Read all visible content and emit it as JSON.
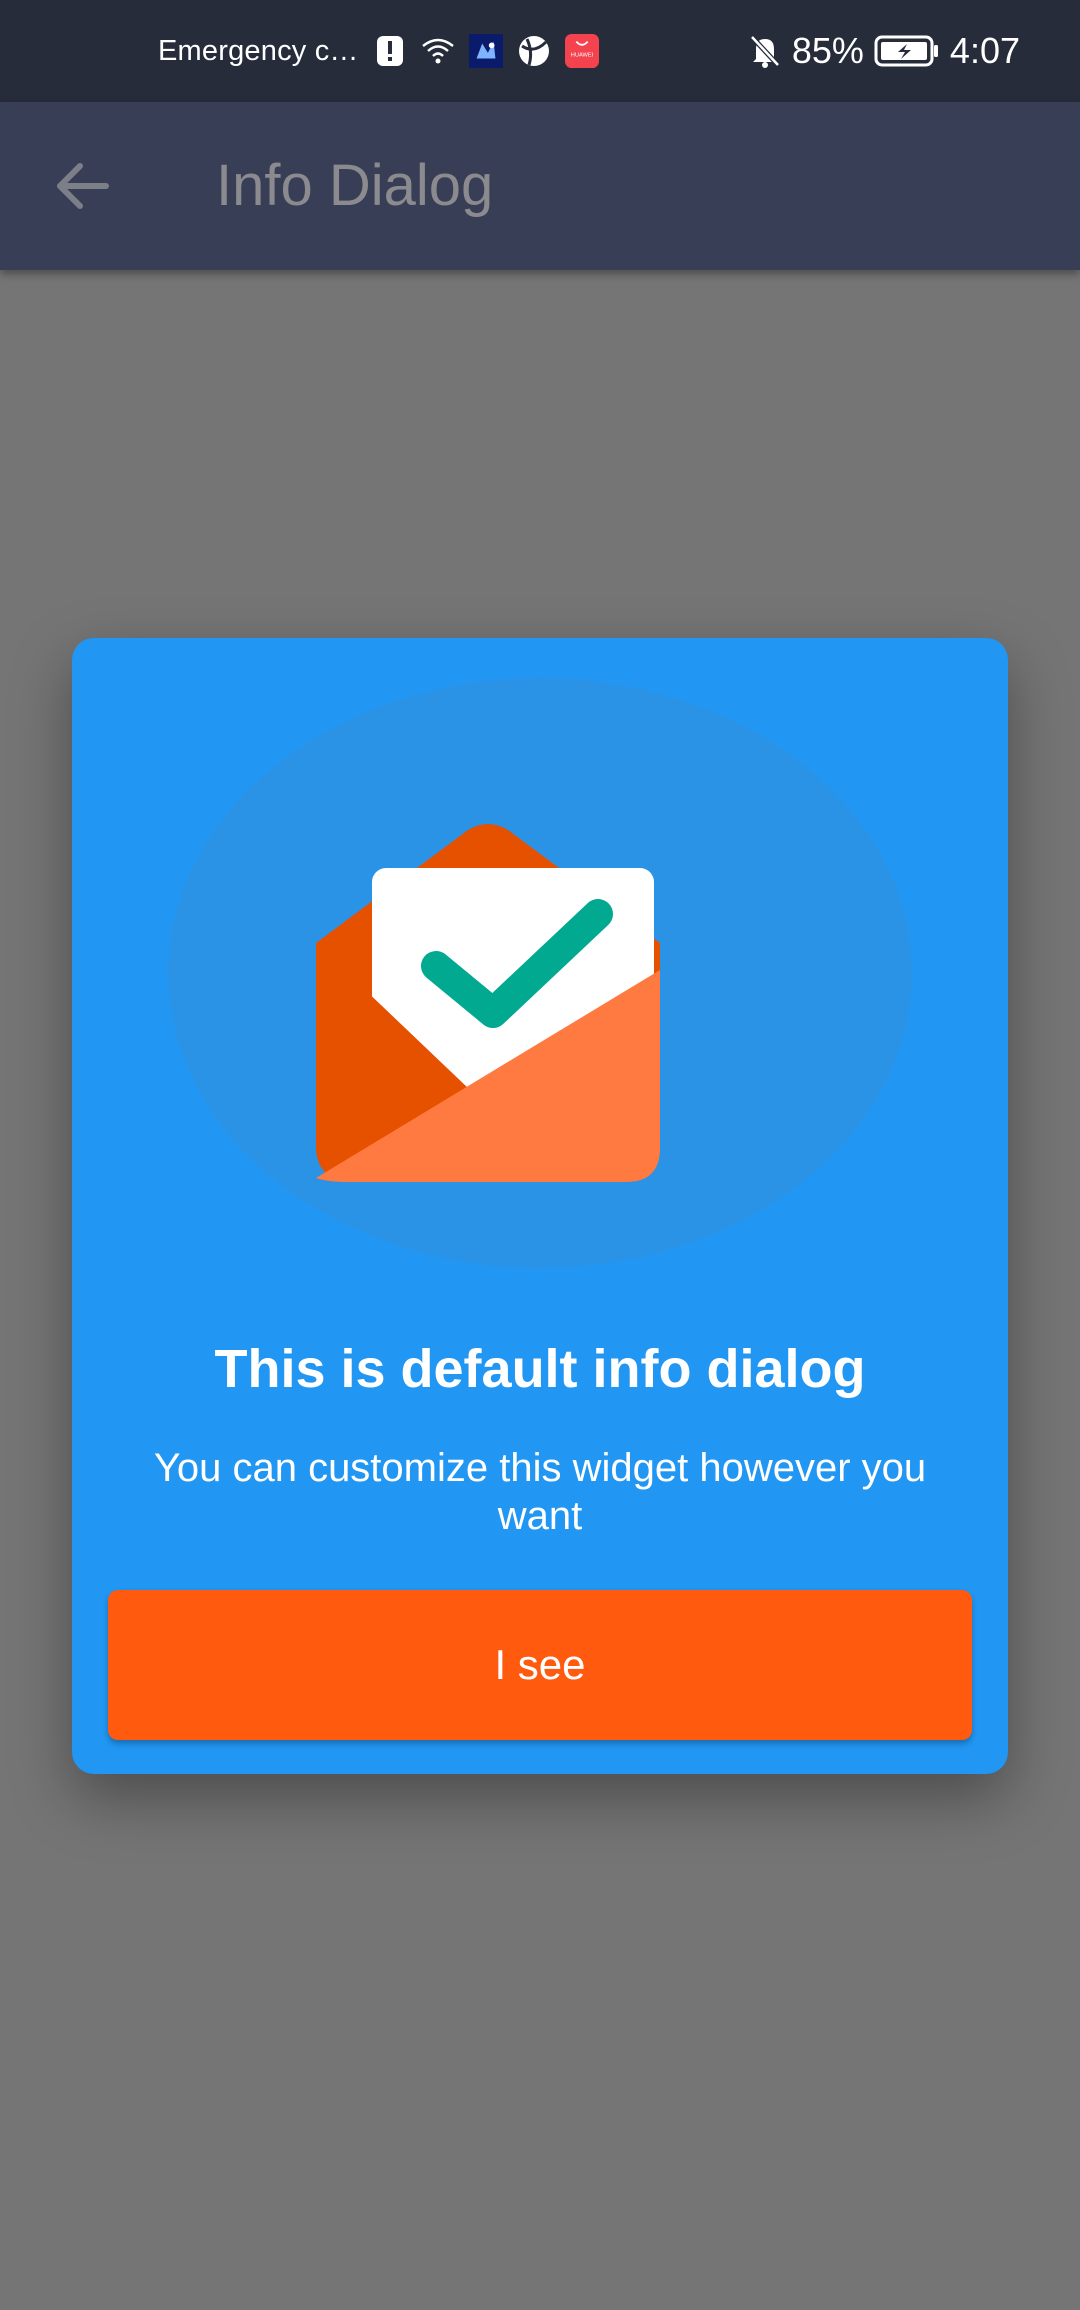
{
  "status_bar": {
    "carrier_text": "Emergency c…",
    "battery_percent": "85%",
    "time": "4:07",
    "icons": [
      "alert-icon",
      "wifi-icon",
      "app-icon",
      "browser-icon",
      "huawei-store-icon",
      "bell-off-icon",
      "battery-charging-icon"
    ],
    "huawei_label": "HUAWEI"
  },
  "app_bar": {
    "title": "Info Dialog",
    "back_icon": "arrow-back-icon"
  },
  "dialog": {
    "illustration": "envelope-check-icon",
    "title": "This is default info dialog",
    "message": "You can customize this widget however you want",
    "button_label": "I see"
  },
  "colors": {
    "status_bar_bg": "#272c3b",
    "app_bar_bg": "#373e55",
    "scrim": "#757575",
    "dialog_bg": "#2196f3",
    "button_bg": "#ff5a0e",
    "envelope_dark": "#e65100",
    "envelope_light": "#ff7a40",
    "check": "#00a98f"
  }
}
